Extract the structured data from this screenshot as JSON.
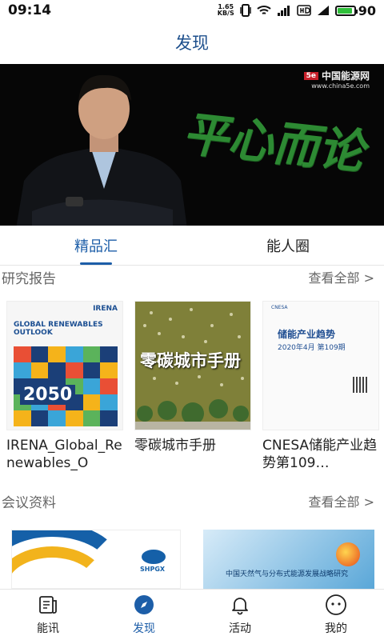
{
  "status_bar": {
    "time": "09:14",
    "net_speed": "1.65",
    "net_unit": "KB/S",
    "battery": "90",
    "battery_level": 0.9
  },
  "header": {
    "title": "发现"
  },
  "banner": {
    "logo_name": "中国能源网",
    "logo_url": "www.china5e.com",
    "slogan": "平心而论"
  },
  "tabs": [
    {
      "label": "精品汇",
      "active": true
    },
    {
      "label": "能人圈",
      "active": false
    }
  ],
  "reports_section": {
    "title": "研究报告",
    "more": "查看全部 >",
    "items": [
      {
        "name": "IRENA_Global_Renewables_O",
        "cover_brand": "IRENA",
        "cover_title": "GLOBAL RENEWABLES OUTLOOK",
        "cover_year": "2050"
      },
      {
        "name": "零碳城市手册",
        "cover_title": "零碳城市手册"
      },
      {
        "name": "CNESA储能产业趋势第109…",
        "cover_title": "储能产业趋势",
        "cover_issue": "2020年4月   第109期"
      }
    ]
  },
  "conference_section": {
    "title": "会议资料",
    "more": "查看全部 >",
    "items": [
      {
        "logo_text": "SHPGX"
      },
      {
        "cover_text": "中国天然气与分布式能源发展战略研究"
      }
    ]
  },
  "bottom_nav": [
    {
      "label": "能讯",
      "icon": "news-icon",
      "active": false
    },
    {
      "label": "发现",
      "icon": "compass-icon",
      "active": true
    },
    {
      "label": "活动",
      "icon": "bell-icon",
      "active": false
    },
    {
      "label": "我的",
      "icon": "user-icon",
      "active": false
    }
  ],
  "colors": {
    "accent": "#1d5ea8",
    "title": "#1d4f8c",
    "slogan": "#2d8a33"
  }
}
